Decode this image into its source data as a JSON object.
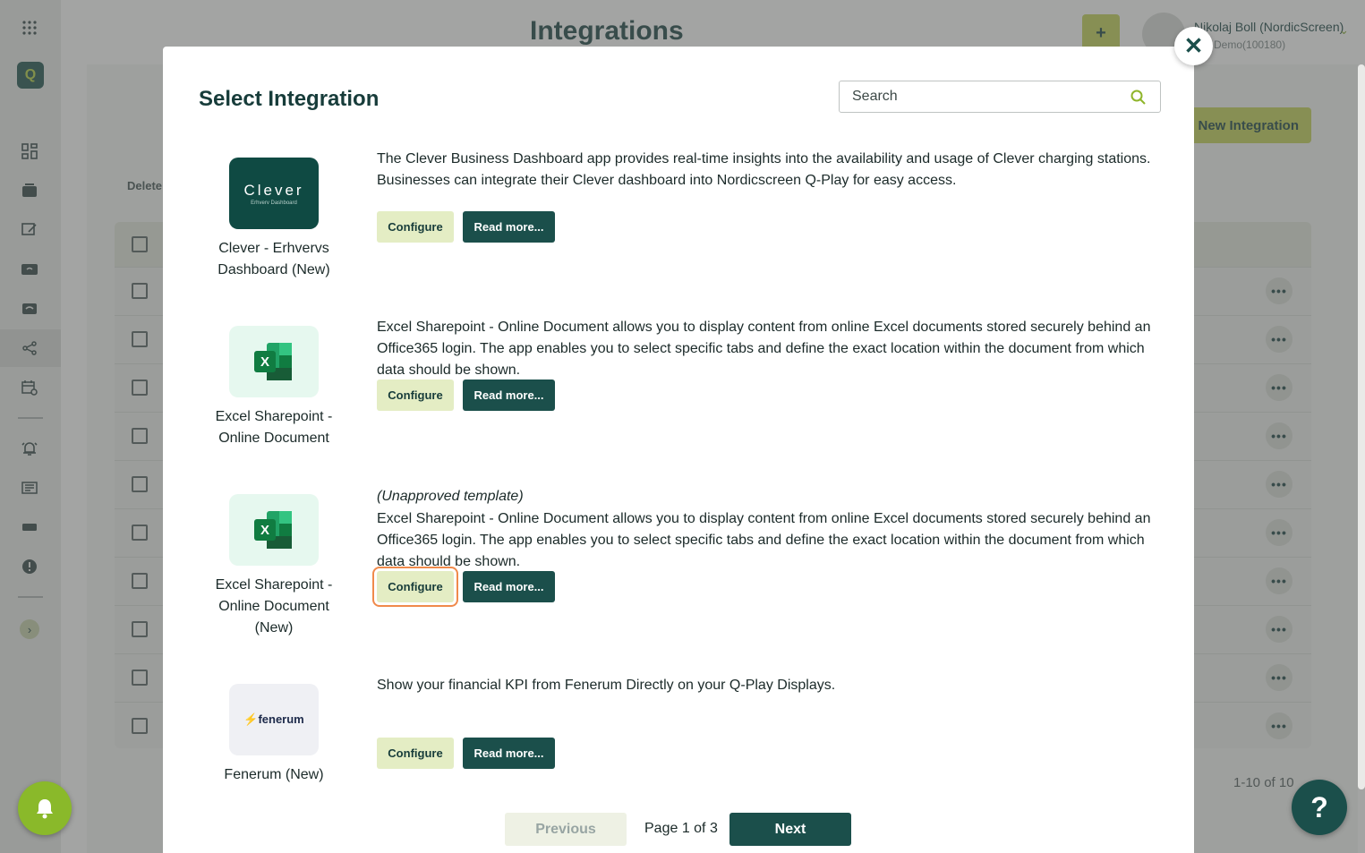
{
  "app": {
    "title": "Integrations",
    "add_label": "+",
    "user_name": "Nikolaj Boll (NordicScreen)",
    "user_org": "olaj Demo(100180)",
    "new_integration_label": "New Integration",
    "delete_label": "Delete",
    "pagination_info": "1-10 of 10",
    "row_count": 10,
    "icons": [
      "apps-grid-icon",
      "dashboard-icon",
      "media-icon",
      "edit-icon",
      "devices-icon",
      "playlist-icon",
      "share-icon",
      "schedule-icon",
      "alarm-icon",
      "news-icon",
      "card-icon",
      "alert-icon",
      "expand-icon"
    ]
  },
  "modal": {
    "title": "Select Integration",
    "search_placeholder": "Search",
    "close_label": "✕",
    "items": [
      {
        "logo": "Clever",
        "logo_sub": "Erhverv Dashboard",
        "name": "Clever - Erhvervs Dashboard (New)",
        "note": "",
        "description": "The Clever Business Dashboard app provides real-time insights into the availability and usage of Clever charging stations. Businesses can integrate their Clever dashboard into Nordicscreen Q-Play for easy access.",
        "configure_label": "Configure",
        "read_more_label": "Read more..."
      },
      {
        "logo": "X",
        "name": "Excel Sharepoint - Online Document",
        "note": "",
        "description": "Excel Sharepoint - Online Document allows you to display content from online Excel documents stored securely behind an Office365 login. The app enables you to select specific tabs and define the exact location within the document from which data should be shown.",
        "configure_label": "Configure",
        "read_more_label": "Read more..."
      },
      {
        "logo": "X",
        "name": "Excel Sharepoint - Online Document (New)",
        "note": "(Unapproved template)",
        "description": "Excel Sharepoint - Online Document allows you to display content from online Excel documents stored securely behind an Office365 login. The app enables you to select specific tabs and define the exact location within the document from which data should be shown.",
        "configure_label": "Configure",
        "read_more_label": "Read more..."
      },
      {
        "logo": "fenerum",
        "name": "Fenerum (New)",
        "note": "",
        "description": "Show your financial KPI from Fenerum Directly on your Q-Play Displays.",
        "configure_label": "Configure",
        "read_more_label": "Read more..."
      }
    ],
    "pagination": {
      "previous_label": "Previous",
      "page_label": "Page 1 of 3",
      "next_label": "Next"
    }
  },
  "help_label": "?",
  "colors": {
    "brand_dark": "#1b4f4b",
    "brand_lime": "#b5c24d",
    "focus_ring": "#f08a4b",
    "excel_green": "#1e7a45"
  }
}
